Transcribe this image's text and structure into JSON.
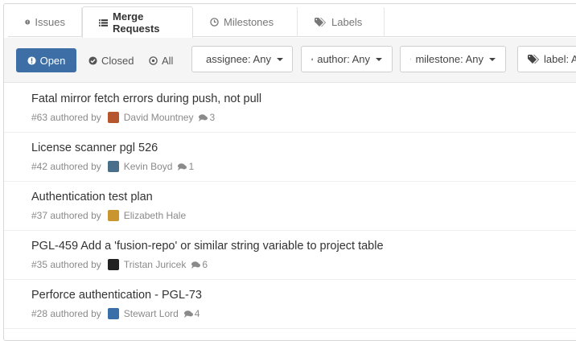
{
  "tabs": [
    {
      "label": "Issues",
      "icon": "exclamation-circle-icon",
      "active": false
    },
    {
      "label": "Merge Requests",
      "icon": "merge-request-icon",
      "active": true
    },
    {
      "label": "Milestones",
      "icon": "clock-icon",
      "active": false
    },
    {
      "label": "Labels",
      "icon": "tags-icon",
      "active": false
    }
  ],
  "state_filters": {
    "open": "Open",
    "closed": "Closed",
    "all": "All"
  },
  "dropdowns": {
    "assignee": "assignee: Any",
    "author": "author: Any",
    "milestone": "milestone: Any",
    "label": "label: A"
  },
  "merge_requests": [
    {
      "title": "Fatal mirror fetch errors during push, not pull",
      "iid": "#63 authored by",
      "author": "David Mountney",
      "comments": "3",
      "avatar_color": "#b5562f"
    },
    {
      "title": "License scanner pgl 526",
      "iid": "#42 authored by",
      "author": "Kevin Boyd",
      "comments": "1",
      "avatar_color": "#4a6f8a"
    },
    {
      "title": "Authentication test plan",
      "iid": "#37 authored by",
      "author": "Elizabeth Hale",
      "comments": null,
      "avatar_color": "#c8952e"
    },
    {
      "title": "PGL-459 Add a 'fusion-repo' or similar string variable to project table",
      "iid": "#35 authored by",
      "author": "Tristan Juricek",
      "comments": "6",
      "avatar_color": "#222222"
    },
    {
      "title": "Perforce authentication - PGL-73",
      "iid": "#28 authored by",
      "author": "Stewart Lord",
      "comments": "4",
      "avatar_color": "#3a6fa8"
    }
  ],
  "colors": {
    "primary": "#3d6fa6",
    "muted_text": "#8a8a8a",
    "filter_bg": "#f5f5f5"
  }
}
